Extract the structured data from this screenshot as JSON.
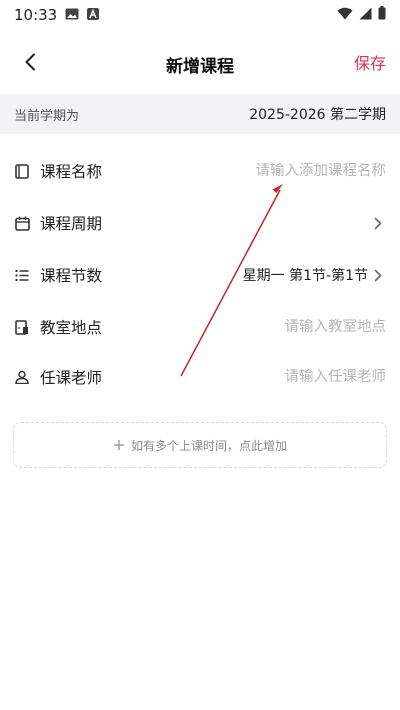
{
  "status_bar": {
    "time": "10:33",
    "icons": [
      "image-icon",
      "app-a-icon",
      "wifi-icon",
      "signal-icon",
      "battery-icon"
    ]
  },
  "header": {
    "title": "新增课程",
    "save_label": "保存",
    "back_icon": "chevron-left-icon"
  },
  "term": {
    "label": "当前学期为",
    "value": "2025-2026 第二学期"
  },
  "form": {
    "course_name": {
      "label": "课程名称",
      "placeholder": "请输入添加课程名称",
      "icon": "notebook-icon"
    },
    "course_weeks": {
      "label": "课程周期",
      "value": "",
      "icon": "calendar-icon"
    },
    "course_sessions": {
      "label": "课程节数",
      "value": "星期一 第1节-第1节",
      "icon": "list-icon"
    },
    "classroom": {
      "label": "教室地点",
      "placeholder": "请输入教室地点",
      "icon": "door-icon"
    },
    "teacher": {
      "label": "任课老师",
      "placeholder": "请输入任课老师",
      "icon": "person-icon"
    }
  },
  "add_time": {
    "label": "如有多个上课时间，点此增加",
    "icon": "plus-icon"
  },
  "colors": {
    "accent": "#e0334a",
    "term_bar_bg": "#f2f2f4",
    "annotation_arrow": "#c0282e"
  }
}
